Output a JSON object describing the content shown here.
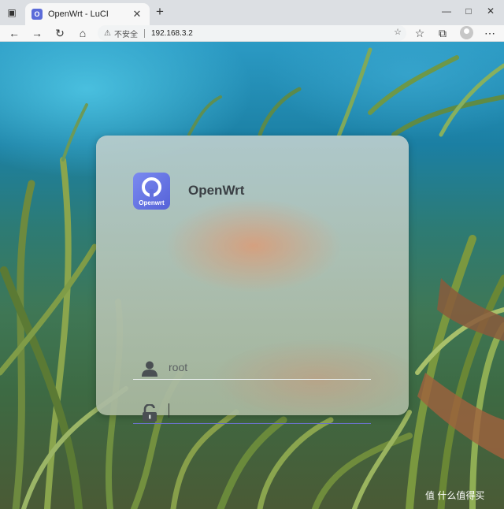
{
  "browser": {
    "tab_title": "OpenWrt - LuCI",
    "favicon_icon": "openwrt-favicon",
    "security_label": "不安全",
    "url": "192.168.3.2"
  },
  "login": {
    "brand": "OpenWrt",
    "logo_text": "Openwrt",
    "username_value": "root",
    "password_value": ""
  },
  "watermark": {
    "text": "值 什么值得买"
  },
  "colors": {
    "accent": "#5b6bd9",
    "focus_underline": "#6a72c8"
  }
}
